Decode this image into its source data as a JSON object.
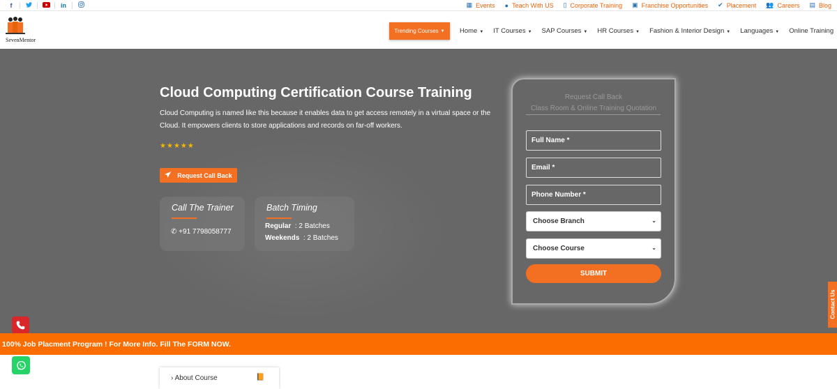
{
  "topbar": {
    "social": [
      {
        "icon": "facebook-icon",
        "glyph": "f",
        "color": "#3b5998"
      },
      {
        "icon": "twitter-icon",
        "glyph": "🐦",
        "color": "#1da1f2"
      },
      {
        "icon": "youtube-icon",
        "glyph": "▶",
        "color": "#cc0000"
      },
      {
        "icon": "linkedin-icon",
        "glyph": "in",
        "color": "#0e76a8"
      },
      {
        "icon": "instagram-icon",
        "glyph": "◎",
        "color": "#2a6fb0"
      }
    ],
    "links": [
      {
        "icon": "calendar-icon",
        "label": "Events"
      },
      {
        "icon": "user-icon",
        "label": "Teach With US"
      },
      {
        "icon": "document-icon",
        "label": "Corporate Training"
      },
      {
        "icon": "badge-icon",
        "label": "Franchise Opportunities"
      },
      {
        "icon": "check-icon",
        "label": "Placement"
      },
      {
        "icon": "users-icon",
        "label": "Careers"
      },
      {
        "icon": "book-icon",
        "label": "Blog"
      }
    ]
  },
  "nav": {
    "logo_text": "SevenMentor",
    "trending": "Trending Courses",
    "items": [
      {
        "label": "Home",
        "dropdown": true
      },
      {
        "label": "IT Courses",
        "dropdown": true
      },
      {
        "label": "SAP Courses",
        "dropdown": true
      },
      {
        "label": "HR Courses",
        "dropdown": true
      },
      {
        "label": "Fashion & Interior Design",
        "dropdown": true
      },
      {
        "label": "Languages",
        "dropdown": true
      },
      {
        "label": "Online Training",
        "dropdown": false
      }
    ]
  },
  "hero": {
    "title": "Cloud Computing Certification Course Training",
    "description": "Cloud Computing is named like this because it enables data to get access remotely in a virtual space or the Cloud. It empowers clients to store applications and records on far-off workers.",
    "rating": 5,
    "request_button": "Request Call Back",
    "trainer_card": {
      "heading": "Call The Trainer",
      "phone": "+91 7798058777"
    },
    "batch_card": {
      "heading": "Batch Timing",
      "rows": [
        {
          "label": "Regular",
          "value": ": 2 Batches"
        },
        {
          "label": "Weekends",
          "value": ": 2 Batches"
        }
      ]
    }
  },
  "form": {
    "heading1": "Request Call Back",
    "heading2": "Class Room & Online Training Quotation",
    "fields": [
      {
        "placeholder": "Full Name *"
      },
      {
        "placeholder": "Email *"
      },
      {
        "placeholder": "Phone Number *"
      }
    ],
    "selects": [
      {
        "value": "Choose Branch"
      },
      {
        "value": "Choose Course"
      }
    ],
    "submit": "SUBMIT"
  },
  "contact_tab": "Contact Us",
  "banner": "100% Job Placment Program ! For More Info. Fill The FORM NOW.",
  "about": {
    "label": "About Course"
  },
  "colors": {
    "accent": "#f36f21",
    "hero_bg": "#676767",
    "banner": "#fb6d00",
    "link_icon": "#2a6fb0"
  }
}
